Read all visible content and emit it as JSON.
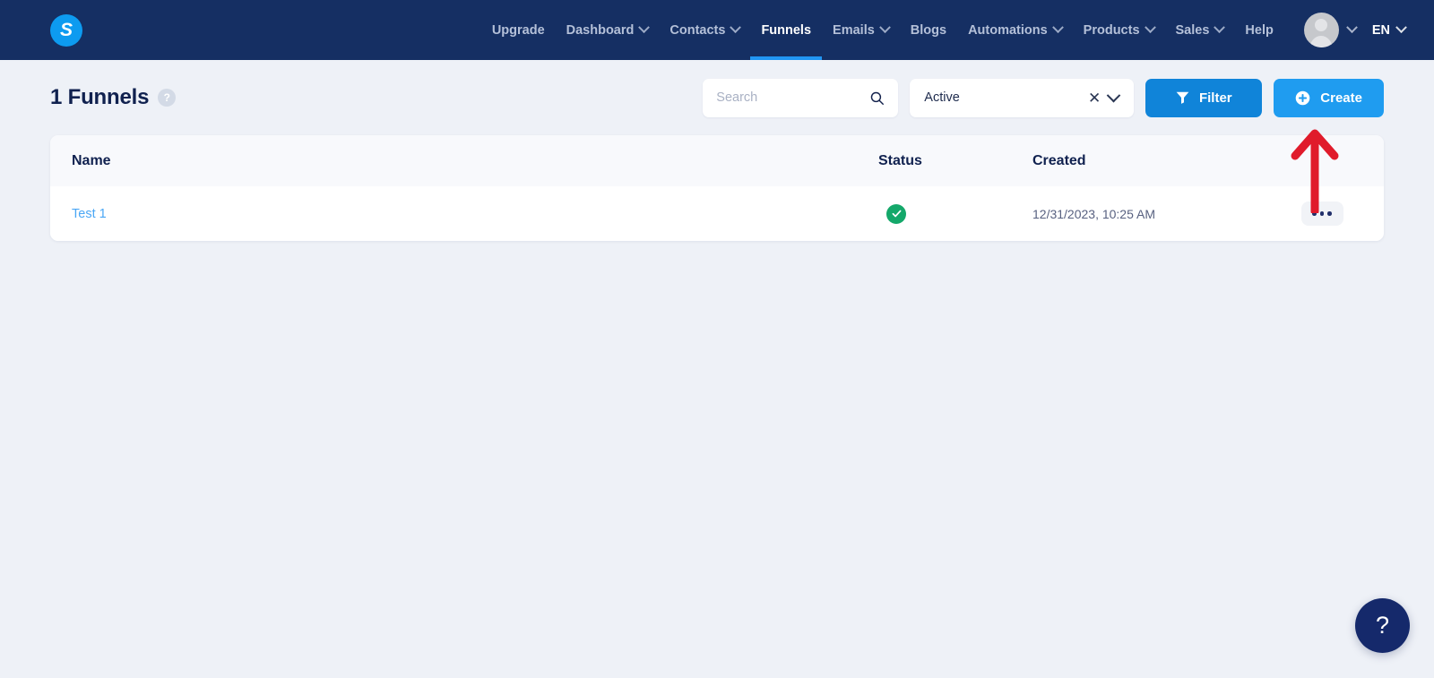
{
  "brand": {
    "logo_letter": "S",
    "logo_color": "#0d9bf0"
  },
  "topnav": {
    "background": "#152f63",
    "active_underline_color": "#2196f3",
    "items": [
      {
        "label": "Upgrade",
        "has_chevron": false,
        "active": false
      },
      {
        "label": "Dashboard",
        "has_chevron": true,
        "active": false
      },
      {
        "label": "Contacts",
        "has_chevron": true,
        "active": false
      },
      {
        "label": "Funnels",
        "has_chevron": false,
        "active": true
      },
      {
        "label": "Emails",
        "has_chevron": true,
        "active": false
      },
      {
        "label": "Blogs",
        "has_chevron": false,
        "active": false
      },
      {
        "label": "Automations",
        "has_chevron": true,
        "active": false
      },
      {
        "label": "Products",
        "has_chevron": true,
        "active": false
      },
      {
        "label": "Sales",
        "has_chevron": true,
        "active": false
      },
      {
        "label": "Help",
        "has_chevron": false,
        "active": false
      }
    ],
    "account": {
      "avatar_icon": "user-avatar-icon",
      "chevron_icon": "chevron-down-icon"
    },
    "language": {
      "label": "EN",
      "chevron_icon": "chevron-down-icon"
    }
  },
  "page": {
    "title": "1 Funnels",
    "title_help_icon": "question-mark-icon",
    "search": {
      "value": "",
      "placeholder": "Search",
      "icon": "search-icon"
    },
    "status_filter": {
      "value": "Active",
      "clear_icon": "close-icon",
      "chevron_icon": "chevron-down-icon"
    },
    "filter_button": {
      "label": "Filter",
      "icon": "funnel-icon",
      "color": "#1084d9"
    },
    "create_button": {
      "label": "Create",
      "icon": "plus-circle-icon",
      "color": "#1f9cf0"
    }
  },
  "table": {
    "columns": [
      "Name",
      "Status",
      "Created"
    ],
    "rows": [
      {
        "name": "Test 1",
        "status_icon": "check-circle-icon",
        "status_color": "#14a86a",
        "created": "12/31/2023, 10:25 AM",
        "actions_icon": "ellipsis-icon"
      }
    ]
  },
  "annotation": {
    "type": "arrow",
    "direction": "up",
    "color": "#e01b2b"
  },
  "help_fab": {
    "label": "?",
    "color": "#15296b"
  }
}
